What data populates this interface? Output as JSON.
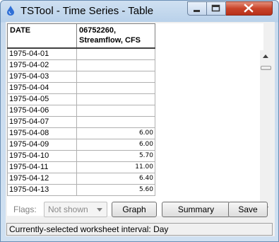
{
  "window": {
    "title": "TSTool - Time Series - Table"
  },
  "table": {
    "columns": [
      "DATE",
      "06752260,\nStreamflow, CFS"
    ],
    "col1_line1": "06752260,",
    "col1_line2": "Streamflow, CFS",
    "rows": [
      {
        "date": "1975-04-01",
        "value": ""
      },
      {
        "date": "1975-04-02",
        "value": ""
      },
      {
        "date": "1975-04-03",
        "value": ""
      },
      {
        "date": "1975-04-04",
        "value": ""
      },
      {
        "date": "1975-04-05",
        "value": ""
      },
      {
        "date": "1975-04-06",
        "value": ""
      },
      {
        "date": "1975-04-07",
        "value": ""
      },
      {
        "date": "1975-04-08",
        "value": "6.00"
      },
      {
        "date": "1975-04-09",
        "value": "6.00"
      },
      {
        "date": "1975-04-10",
        "value": "5.70"
      },
      {
        "date": "1975-04-11",
        "value": "11.00"
      },
      {
        "date": "1975-04-12",
        "value": "6.40"
      },
      {
        "date": "1975-04-13",
        "value": "5.60"
      }
    ]
  },
  "toolbar": {
    "flags_label": "Flags:",
    "flags_value": "Not shown",
    "graph_label": "Graph",
    "summary_label": "Summary",
    "save_label": "Save"
  },
  "status": {
    "text": "Currently-selected worksheet interval: Day"
  },
  "colors": {
    "close_button": "#c9442a",
    "title_bar": "#b9d1ea"
  }
}
